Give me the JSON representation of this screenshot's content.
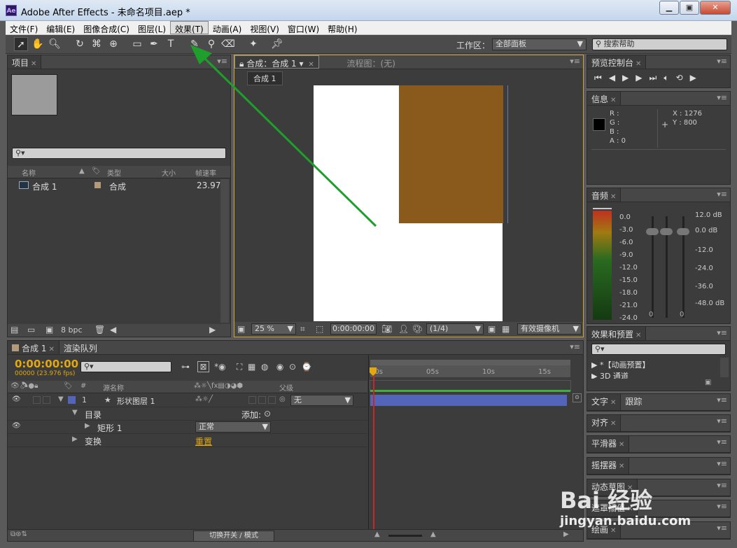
{
  "window": {
    "title": "Adobe After Effects - 未命名项目.aep *",
    "logo": "Ae"
  },
  "menu": [
    "文件(F)",
    "编辑(E)",
    "图像合成(C)",
    "图层(L)",
    "效果(T)",
    "动画(A)",
    "视图(V)",
    "窗口(W)",
    "帮助(H)"
  ],
  "toolbar": {
    "workspace_label": "工作区：",
    "workspace_value": "全部面板",
    "search_help": "搜索帮助"
  },
  "project": {
    "tab": "项目",
    "cols": [
      "名称",
      "类型",
      "大小",
      "帧速率"
    ],
    "item": {
      "name": "合成 1",
      "type": "合成",
      "fps": "23.976"
    },
    "bpc": "8 bpc"
  },
  "comp": {
    "tab": "合成：合成 1",
    "flow_tab": "流程图：(无)",
    "crumb": "合成 1",
    "zoom": "25 %",
    "time": "0:00:00:00",
    "res": "(1/4)",
    "camera": "有效摄像机",
    "solid_color": "#8a5a1c"
  },
  "preview": {
    "tab": "预览控制台"
  },
  "info": {
    "tab": "信息",
    "r": "R :",
    "g": "G :",
    "b": "B :",
    "a": "A : 0",
    "x": "X : 1276",
    "y": "Y : 800"
  },
  "audio": {
    "tab": "音频",
    "left_scale": [
      "0.0",
      "-3.0",
      "-6.0",
      "-9.0",
      "-12.0",
      "-15.0",
      "-18.0",
      "-21.0",
      "-24.0"
    ],
    "right_scale": [
      "12.0 dB",
      "0.0 dB",
      "-12.0",
      "-24.0",
      "-36.0",
      "-48.0 dB"
    ],
    "zero_a": "0",
    "zero_b": "0"
  },
  "effects": {
    "tab": "效果和预置",
    "items": [
      "▶ *【动画预置】",
      "▶ 3D 通道"
    ]
  },
  "side_panels": [
    {
      "name": "文字",
      "extra": "跟踪"
    },
    {
      "name": "对齐"
    },
    {
      "name": "平滑器"
    },
    {
      "name": "摇摆器"
    },
    {
      "name": "动态草图"
    },
    {
      "name": "遮罩插值"
    },
    {
      "name": "绘画"
    }
  ],
  "timeline": {
    "tab": "合成 1",
    "render_tab": "渲染队列",
    "timecode": "0:00:00:00",
    "frames": "00000 (23.976 fps)",
    "layer_col": "源名称",
    "parent_col": "父级",
    "rulers": [
      "00s",
      "05s",
      "10s",
      "15s"
    ],
    "layer": {
      "num": "1",
      "name": "形状图层 1",
      "parent": "无"
    },
    "contents": "目录",
    "add": "添加:",
    "rect": "矩形 1",
    "blend": "正常",
    "transform": "变换",
    "reset": "重置",
    "switch": "切换开关 / 模式"
  },
  "watermark": {
    "brand": "Bai 经验",
    "url": "jingyan.baidu.com"
  },
  "colors": {
    "arrow": "#1e9e2a",
    "accent": "#e2a80f",
    "layer_bar": "#5464b8"
  }
}
